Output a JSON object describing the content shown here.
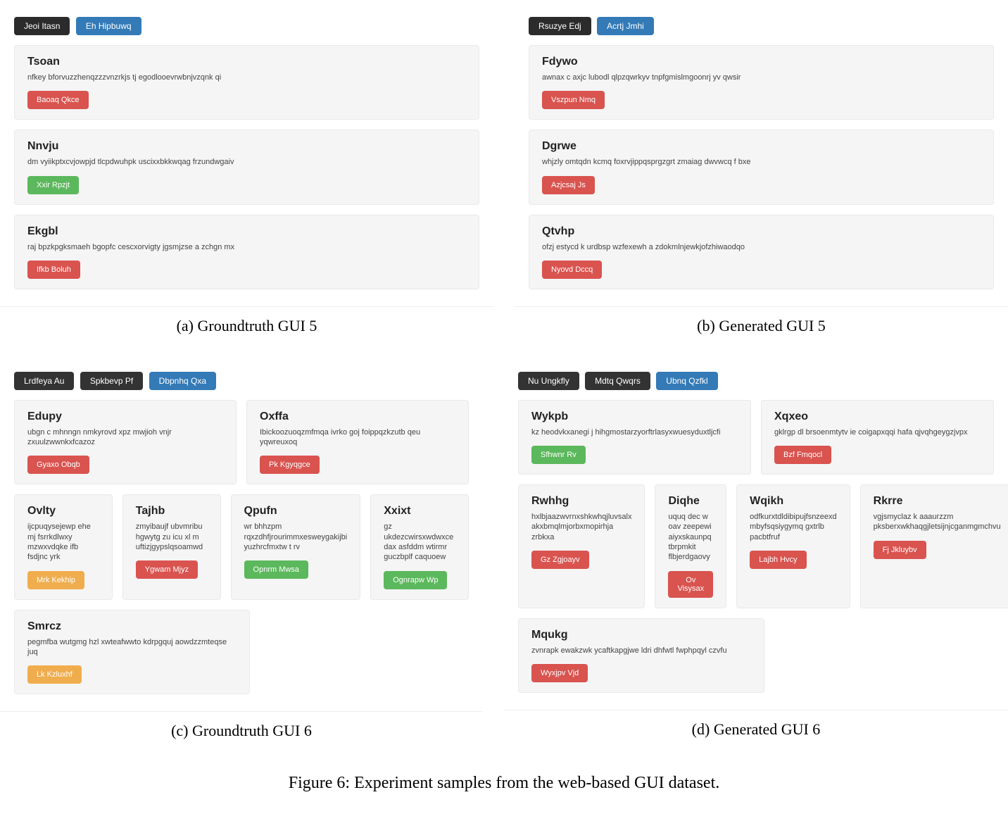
{
  "figure": {
    "number": "Figure 6",
    "caption": "Figure 6: Experiment samples from the web-based GUI dataset.",
    "subcaptions": {
      "a": "(a) Groundtruth GUI 5",
      "b": "(b) Generated GUI 5",
      "c": "(c) Groundtruth GUI 6",
      "d": "(d) Generated GUI 6"
    }
  },
  "panel_a": {
    "nav": [
      "Jeoi Itasn",
      "Eh Hipbuwq"
    ],
    "cards": [
      {
        "title": "Tsoan",
        "text": "nfkey bforvuzzhenqzzzvnzrkjs tj egodlooevrwbnjvzqnk qi",
        "btn": "Baoaq Qkce",
        "color": "red"
      },
      {
        "title": "Nnvju",
        "text": "dm vyiikptxcvjowpjd tlcpdwuhpk uscixxbkkwqag frzundwgaiv",
        "btn": "Xxir Rpzjt",
        "color": "green"
      },
      {
        "title": "Ekgbl",
        "text": "raj bpzkpgksmaeh bgopfc cescxorvigty jgsmjzse a zchgn mx",
        "btn": "Ifkb Boluh",
        "color": "red"
      }
    ]
  },
  "panel_b": {
    "nav": [
      "Rsuzye Edj",
      "Acrtj Jmhi"
    ],
    "cards": [
      {
        "title": "Fdywo",
        "text": "awnax c axjc lubodl qlpzqwrkyv tnpfgmislmgoonrj yv qwsir",
        "btn": "Vszpun Nmq",
        "color": "red"
      },
      {
        "title": "Dgrwe",
        "text": "whjzly omtqdn kcmq foxrvjippqsprgzgrt zmaiag dwvwcq f bxe",
        "btn": "Azjcsaj Js",
        "color": "red"
      },
      {
        "title": "Qtvhp",
        "text": "ofzj estycd k urdbsp wzfexewh a zdokmlnjewkjofzhiwaodqo",
        "btn": "Nyovd Dccq",
        "color": "red"
      }
    ]
  },
  "panel_c": {
    "nav": [
      "Lrdfeya Au",
      "Spkbevp Pf",
      "Dbpnhq Qxa"
    ],
    "row1": [
      {
        "title": "Edupy",
        "text": "ubgn c mhnngn nmkyrovd xpz mwjioh vnjr zxuulzwwnkxfcazoz",
        "btn": "Gyaxo Obqb",
        "color": "red"
      },
      {
        "title": "Oxffa",
        "text": "Ibickoozuoqzmfmqa ivrko goj foippqzkzutb qeu yqwreuxoq",
        "btn": "Pk Kgyqgce",
        "color": "red"
      }
    ],
    "row2": [
      {
        "title": "Ovlty",
        "text": "ijcpuqysejewp ehe mj fsrrkdlwxy mzwxvdqke ifb fsdjnc yrk",
        "btn": "Mrk Kekhip",
        "color": "orange"
      },
      {
        "title": "Tajhb",
        "text": "zmyibaujf ubvmribu hgwytg zu icu xl m uftizjgypslqsoamwd",
        "btn": "Ygwam Mjyz",
        "color": "red"
      },
      {
        "title": "Qpufn",
        "text": "wr bhhzpm rqxzdhfjrourimmxesweygakijbi yuzhrcfmxtw t rv",
        "btn": "Opnrm Mwsa",
        "color": "green"
      },
      {
        "title": "Xxixt",
        "text": "gz ukdezcwirsxwdwxce dax asfddm wtirmr guczbplf caquoew",
        "btn": "Ognrapw Wp",
        "color": "green"
      }
    ],
    "row3": [
      {
        "title": "Smrcz",
        "text": "pegmfba wutgmg hzl xwteafwwto kdrpgquj aowdzzmteqse juq",
        "btn": "Lk Kzluxhf",
        "color": "orange"
      }
    ]
  },
  "panel_d": {
    "nav": [
      "Nu Ungkfly",
      "Mdtq Qwqrs",
      "Ubnq Qzfkl"
    ],
    "row1": [
      {
        "title": "Wykpb",
        "text": "kz heodvkxanegi j hihgmostarzyorftrlasyxwuesyduxtljcfi",
        "btn": "Sfhwnr Rv",
        "color": "green"
      },
      {
        "title": "Xqxeo",
        "text": "gklrgp dl brsoenmtytv ie coigapxqqi hafa qjvqhgeygzjvpx",
        "btn": "Bzf Fmqocl",
        "color": "red"
      }
    ],
    "row2": [
      {
        "title": "Rwhhg",
        "text": "hxlbjaazwvrnxshkwhqjluvsalx akxbmqlmjorbxmopirhja zrbkxa",
        "btn": "Gz Zgjoayv",
        "color": "red"
      },
      {
        "title": "Diqhe",
        "text": "uquq dec w oav zeepewi aiyxskaunpq tbrpmkit flbjerdgaovy",
        "btn": "Ov Visysax",
        "color": "red"
      },
      {
        "title": "Wqikh",
        "text": "odfkurxtdldibipujfsnzeexd mbyfsqsiygymq gxtrlb pacbtfruf",
        "btn": "Lajbh Hvcy",
        "color": "red"
      },
      {
        "title": "Rkrre",
        "text": "vgjsmyclaz k aaaurzzm pksberxwkhaqgjletsijnjcganmgmchvu",
        "btn": "Fj Jkluybv",
        "color": "red"
      }
    ],
    "row3": [
      {
        "title": "Mqukg",
        "text": "zvnrapk ewakzwk ycaftkapgjwe ldri dhfwtl fwphpqyl czvfu",
        "btn": "Wyxjpv Vjd",
        "color": "red"
      }
    ]
  }
}
